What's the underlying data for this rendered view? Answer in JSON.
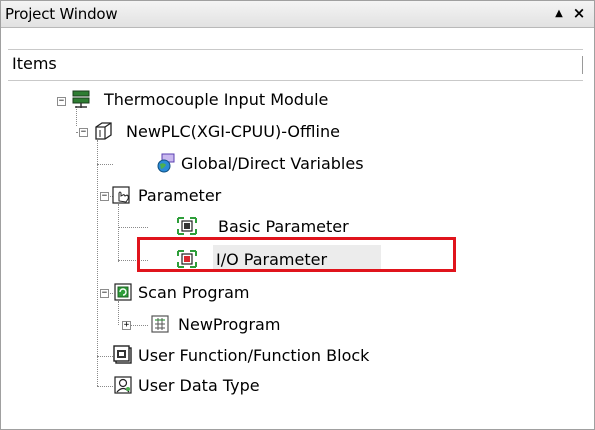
{
  "window": {
    "title": "Project Window",
    "pin_glyph": "▲",
    "close_glyph": "×"
  },
  "header": {
    "label": "Items"
  },
  "tree": {
    "root": "Thermocouple Input Module",
    "plc": "NewPLC(XGI-CPUU)-Offline",
    "global_vars": "Global/Direct Variables",
    "parameter": "Parameter",
    "basic_param": "Basic Parameter",
    "io_param": "I/O Parameter",
    "scan_program": "Scan Program",
    "new_program": "NewProgram",
    "user_function": "User Function/Function Block",
    "user_data_type": "User Data Type"
  },
  "expanders": {
    "expanded": "−",
    "collapsed": "+"
  },
  "colors": {
    "highlight": "#e0141c",
    "selection": "#ececec"
  }
}
